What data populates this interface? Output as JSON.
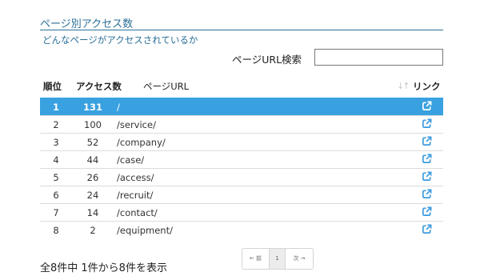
{
  "section": {
    "title": "ページ別アクセス数",
    "subtitle": "どんなページがアクセスされているか"
  },
  "search": {
    "label": "ページURL検索",
    "value": ""
  },
  "table": {
    "headers": {
      "rank": "順位",
      "count": "アクセス数",
      "url": "ページURL",
      "link": "リンク"
    },
    "rows": [
      {
        "rank": "1",
        "count": "131",
        "url": "/"
      },
      {
        "rank": "2",
        "count": "100",
        "url": "/service/"
      },
      {
        "rank": "3",
        "count": "52",
        "url": "/company/"
      },
      {
        "rank": "4",
        "count": "44",
        "url": "/case/"
      },
      {
        "rank": "5",
        "count": "26",
        "url": "/access/"
      },
      {
        "rank": "6",
        "count": "24",
        "url": "/recruit/"
      },
      {
        "rank": "7",
        "count": "14",
        "url": "/contact/"
      },
      {
        "rank": "8",
        "count": "2",
        "url": "/equipment/"
      }
    ],
    "sort_icon": "sort-icon",
    "link_icon": "external-link-icon"
  },
  "summary": "全8件中 1件から8件を表示",
  "pagination": {
    "prev": "← 前",
    "page": "1",
    "next": "次 →"
  },
  "colors": {
    "accent": "#2a6f97",
    "active_row": "#39a1e0",
    "icon": "#3a9be0"
  }
}
